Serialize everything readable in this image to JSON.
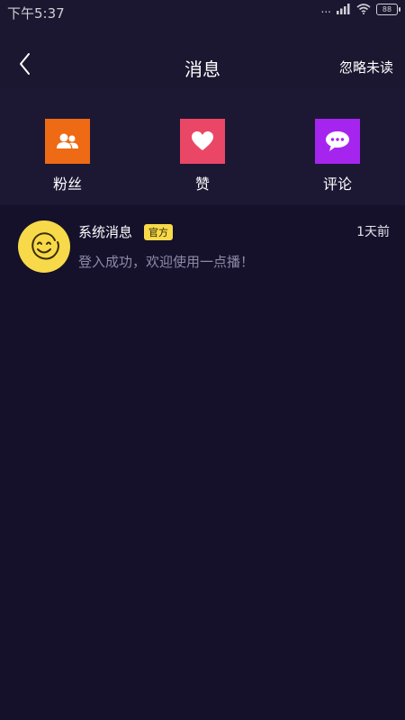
{
  "status_bar": {
    "time": "下午5:37",
    "signal": "...",
    "battery": "88"
  },
  "header": {
    "title": "消息",
    "ignore_unread": "忽略未读"
  },
  "quick_actions": [
    {
      "label": "粉丝",
      "icon": "fans-icon",
      "color": "#ee6a14"
    },
    {
      "label": "赞",
      "icon": "heart-icon",
      "color": "#ea4767"
    },
    {
      "label": "评论",
      "icon": "comment-icon",
      "color": "#a625ee"
    }
  ],
  "messages": [
    {
      "name": "系统消息",
      "badge": "官方",
      "time": "1天前",
      "text": "登入成功，欢迎使用一点播！",
      "avatar_icon": "smiley-icon",
      "avatar_color": "#f7d94a"
    }
  ]
}
